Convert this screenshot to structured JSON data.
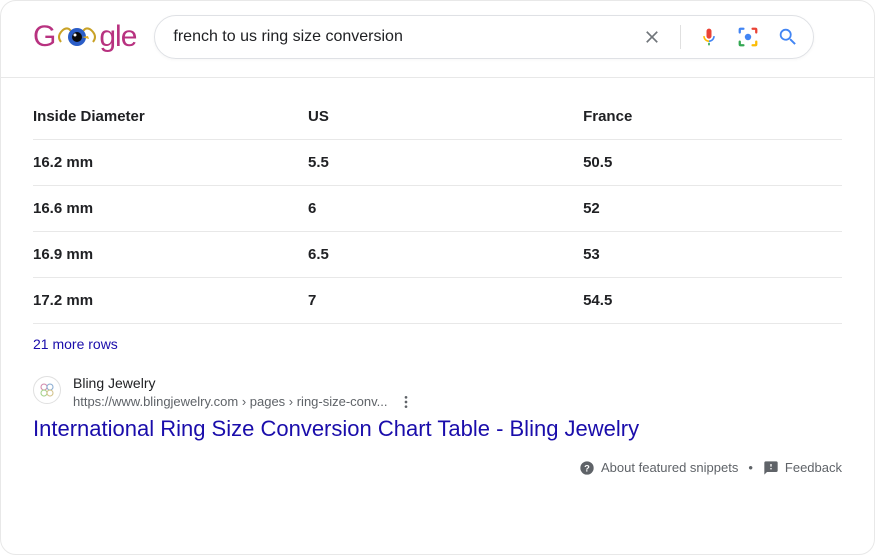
{
  "logo": {
    "parts": [
      "G",
      "g",
      "l",
      "e"
    ]
  },
  "search": {
    "query": "french to us ring size conversion",
    "clear_label": "Clear",
    "voice_label": "Search by voice",
    "lens_label": "Search by image",
    "submit_label": "Search"
  },
  "table": {
    "headers": [
      "Inside Diameter",
      "US",
      "France"
    ],
    "rows": [
      [
        "16.2 mm",
        "5.5",
        "50.5"
      ],
      [
        "16.6 mm",
        "6",
        "52"
      ],
      [
        "16.9 mm",
        "6.5",
        "53"
      ],
      [
        "17.2 mm",
        "7",
        "54.5"
      ]
    ],
    "more_rows": "21 more rows"
  },
  "result": {
    "site_name": "Bling Jewelry",
    "breadcrumb": "https://www.blingjewelry.com › pages › ring-size-conv...",
    "title": "International Ring Size Conversion Chart Table - Bling Jewelry",
    "menu_label": "About this result"
  },
  "footer": {
    "about": "About featured snippets",
    "feedback": "Feedback"
  }
}
